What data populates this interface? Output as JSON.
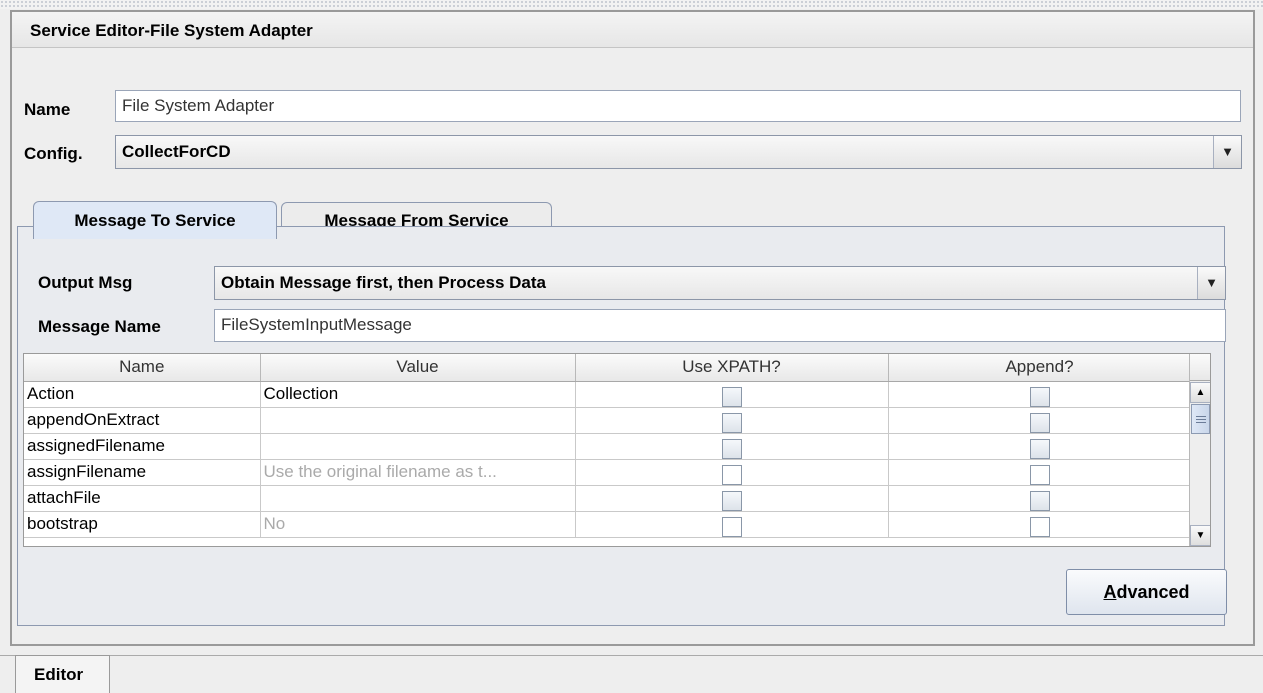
{
  "title": "Service Editor-File System Adapter",
  "name_label": "Name",
  "name_value": "File System Adapter",
  "config_label": "Config.",
  "config_value": "CollectForCD",
  "tabs": [
    {
      "label": "Message To Service",
      "active": true
    },
    {
      "label": "Message From Service",
      "active": false
    }
  ],
  "output_msg_label": "Output Msg",
  "output_msg_value": "Obtain Message first, then Process Data",
  "message_name_label": "Message Name",
  "message_name_value": "FileSystemInputMessage",
  "table": {
    "columns": [
      "Name",
      "Value",
      "Use XPATH?",
      "Append?"
    ],
    "rows": [
      {
        "name": "Action",
        "value": "Collection",
        "value_muted": false
      },
      {
        "name": "appendOnExtract",
        "value": "",
        "value_muted": false
      },
      {
        "name": "assignedFilename",
        "value": "",
        "value_muted": false
      },
      {
        "name": "assignFilename",
        "value": "Use the original filename as t...",
        "value_muted": true
      },
      {
        "name": "attachFile",
        "value": "",
        "value_muted": false
      },
      {
        "name": "bootstrap",
        "value": "No",
        "value_muted": true
      }
    ]
  },
  "advanced_button": {
    "mnemonic": "A",
    "rest": "dvanced"
  },
  "bottom_tab": "Editor",
  "icons": {
    "dropdown": "chevron-down-icon",
    "scroll_up": "arrow-up-icon",
    "scroll_down": "arrow-down-icon"
  }
}
